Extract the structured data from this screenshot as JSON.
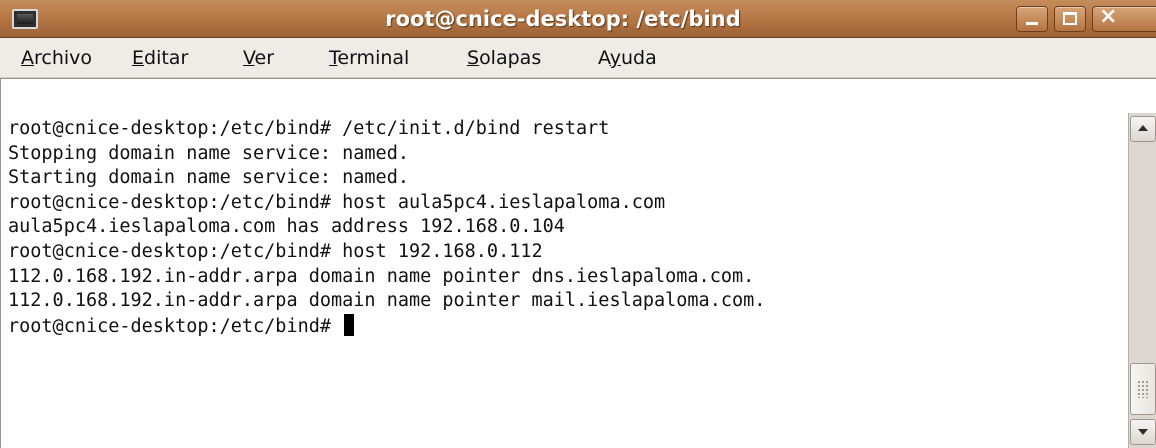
{
  "window": {
    "title": "root@cnice-desktop: /etc/bind",
    "controls": {
      "minimize_icon": "minimize-icon",
      "maximize_icon": "maximize-icon",
      "close_icon": "close-icon",
      "close_glyph": "×"
    }
  },
  "menu": {
    "items": [
      {
        "mnemonic": "A",
        "rest": "rchivo"
      },
      {
        "mnemonic": "E",
        "rest": "ditar"
      },
      {
        "mnemonic": "V",
        "rest": "er"
      },
      {
        "mnemonic": "T",
        "rest": "erminal"
      },
      {
        "mnemonic": "S",
        "rest": "olapas"
      },
      {
        "pre": "A",
        "mnemonic": "y",
        "rest": "uda"
      }
    ]
  },
  "terminal": {
    "lines": [
      "root@cnice-desktop:/etc/bind# /etc/init.d/bind restart",
      "Stopping domain name service: named.",
      "Starting domain name service: named.",
      "root@cnice-desktop:/etc/bind# host aula5pc4.ieslapaloma.com",
      "aula5pc4.ieslapaloma.com has address 192.168.0.104",
      "root@cnice-desktop:/etc/bind# host 192.168.0.112",
      "112.0.168.192.in-addr.arpa domain name pointer dns.ieslapaloma.com.",
      "112.0.168.192.in-addr.arpa domain name pointer mail.ieslapaloma.com."
    ],
    "prompt": "root@cnice-desktop:/etc/bind# "
  },
  "colors": {
    "titlebar": "#b77a47",
    "terminal_bg": "#ffffff",
    "terminal_fg": "#111111",
    "menubar_bg": "#efebe7"
  }
}
